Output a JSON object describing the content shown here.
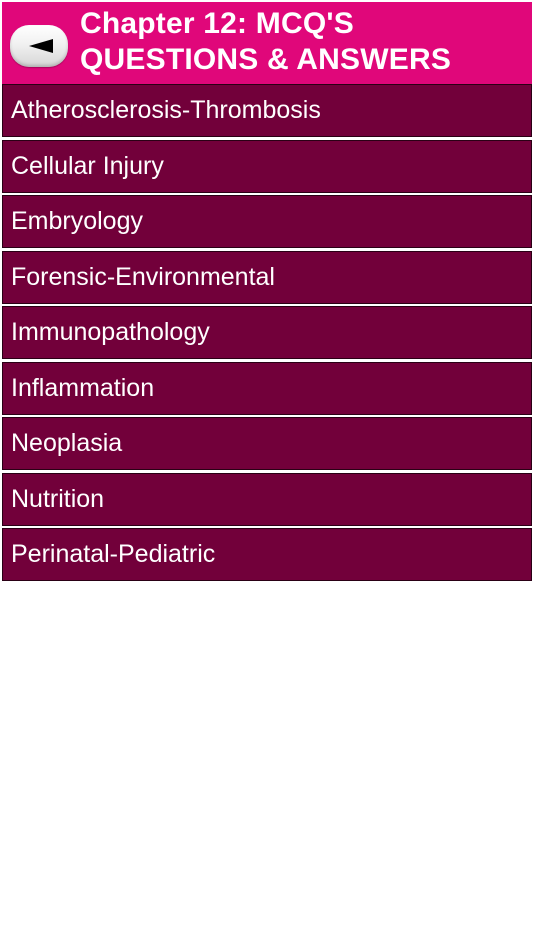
{
  "header": {
    "title_line1": "Chapter 12: MCQ'S",
    "title_line2": "QUESTIONS & ANSWERS",
    "back_icon": "left-arrow-icon",
    "background_color": "#e0077a"
  },
  "list": {
    "item_color": "#72003a",
    "items": [
      {
        "label": "Atherosclerosis-Thrombosis"
      },
      {
        "label": "Cellular Injury"
      },
      {
        "label": "Embryology"
      },
      {
        "label": "Forensic-Environmental"
      },
      {
        "label": "Immunopathology"
      },
      {
        "label": "Inflammation"
      },
      {
        "label": "Neoplasia"
      },
      {
        "label": "Nutrition"
      },
      {
        "label": "Perinatal-Pediatric"
      }
    ]
  }
}
